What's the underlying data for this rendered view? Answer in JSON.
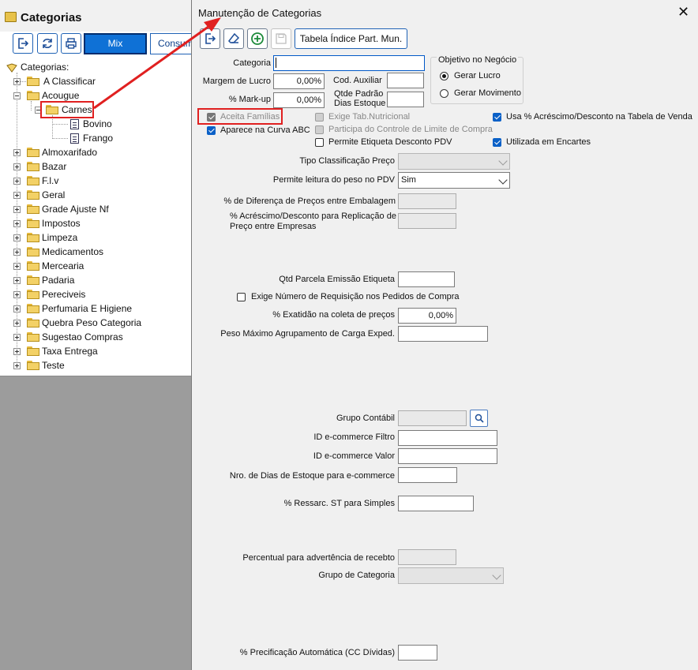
{
  "left_window": {
    "title": "Categorias",
    "toolbar": {
      "mix_label": "Mix",
      "consumo_label": "Consumo"
    },
    "tree": {
      "root": "Categorias:",
      "items": [
        {
          "label": "A Classificar"
        },
        {
          "label": "Acougue",
          "children": [
            {
              "label": "Carnes",
              "children": [
                {
                  "label": "Bovino"
                },
                {
                  "label": "Frango"
                }
              ]
            }
          ]
        },
        {
          "label": "Almoxarifado"
        },
        {
          "label": "Bazar"
        },
        {
          "label": "F.l.v"
        },
        {
          "label": "Geral"
        },
        {
          "label": "Grade Ajuste Nf"
        },
        {
          "label": "Impostos"
        },
        {
          "label": "Limpeza"
        },
        {
          "label": "Medicamentos"
        },
        {
          "label": "Mercearia"
        },
        {
          "label": "Padaria"
        },
        {
          "label": "Pereciveis"
        },
        {
          "label": "Perfumaria E Higiene"
        },
        {
          "label": "Quebra Peso Categoria"
        },
        {
          "label": "Sugestao Compras"
        },
        {
          "label": "Taxa Entrega"
        },
        {
          "label": "Teste"
        }
      ]
    }
  },
  "dialog": {
    "title": "Manutenção de Categorias",
    "close_glyph": "✕",
    "toolbar": {
      "tabela_label": "Tabela Índice Part. Mun."
    },
    "fields": {
      "categoria": {
        "label": "Categoria",
        "value": ""
      },
      "margem_lucro": {
        "label": "Margem de Lucro",
        "value": "0,00%"
      },
      "mark_up": {
        "label": "% Mark-up",
        "value": "0,00%"
      },
      "cod_auxiliar": {
        "label": "Cod. Auxiliar",
        "value": ""
      },
      "qtde_padrao": {
        "label_line1": "Qtde Padrão",
        "label_line2": "Dias Estoque",
        "value": ""
      },
      "tipo_classificacao": {
        "label": "Tipo Classificação Preço",
        "value": ""
      },
      "permite_leitura": {
        "label": "Permite leitura do peso no PDV",
        "value": "Sim"
      },
      "dif_precos": {
        "label": "% de Diferença de Preços entre Embalagem",
        "value": ""
      },
      "acrescimo_replicacao": {
        "label_line1": "% Acréscimo/Desconto para Replicação de",
        "label_line2": "Preço entre Empresas",
        "value": ""
      },
      "qtd_parcela": {
        "label": "Qtd Parcela Emissão Etiqueta",
        "value": ""
      },
      "exatidao": {
        "label": "% Exatidão na coleta de preços",
        "value": "0,00%"
      },
      "peso_maximo": {
        "label": "Peso Máximo Agrupamento de Carga Exped.",
        "value": ""
      },
      "grupo_contabil": {
        "label": "Grupo Contábil",
        "value": ""
      },
      "id_filtro": {
        "label": "ID e-commerce Filtro",
        "value": ""
      },
      "id_valor": {
        "label": "ID e-commerce Valor",
        "value": ""
      },
      "nro_dias": {
        "label": "Nro. de Dias de Estoque para e-commerce",
        "value": ""
      },
      "ressarc": {
        "label": "% Ressarc. ST para Simples",
        "value": ""
      },
      "percentual_adv": {
        "label": "Percentual para advertência de recebto",
        "value": ""
      },
      "grupo_categoria": {
        "label": "Grupo de Categoria",
        "value": ""
      },
      "precificacao": {
        "label": "% Precificação Automática (CC Dívidas)",
        "value": ""
      }
    },
    "objetivo": {
      "legend": "Objetivo no Negócio",
      "options": [
        {
          "label": "Gerar Lucro",
          "selected": true
        },
        {
          "label": "Gerar Movimento",
          "selected": false
        }
      ]
    },
    "checkboxes": {
      "aceita_familias": {
        "label": "Aceita Famílias",
        "checked": true,
        "enabled": false
      },
      "aparece_curva": {
        "label": "Aparece na Curva ABC",
        "checked": true,
        "enabled": true
      },
      "exige_tab": {
        "label": "Exige Tab.Nutricional",
        "checked": false,
        "enabled": false
      },
      "participa_controle": {
        "label": "Participa do Controle de Limite de Compra",
        "checked": false,
        "enabled": false
      },
      "permite_etiqueta": {
        "label": "Permite Etiqueta Desconto PDV",
        "checked": false,
        "enabled": true
      },
      "usa_acrescimo": {
        "label": "Usa % Acréscimo/Desconto na Tabela de Venda",
        "checked": true,
        "enabled": true
      },
      "utilizada_encartes": {
        "label": "Utilizada em Encartes",
        "checked": true,
        "enabled": true
      },
      "exige_requisicao": {
        "label": "Exige Número de Requisição nos Pedidos de Compra",
        "checked": false,
        "enabled": true
      }
    }
  },
  "annotation": {
    "highlight_color": "#e02020"
  }
}
